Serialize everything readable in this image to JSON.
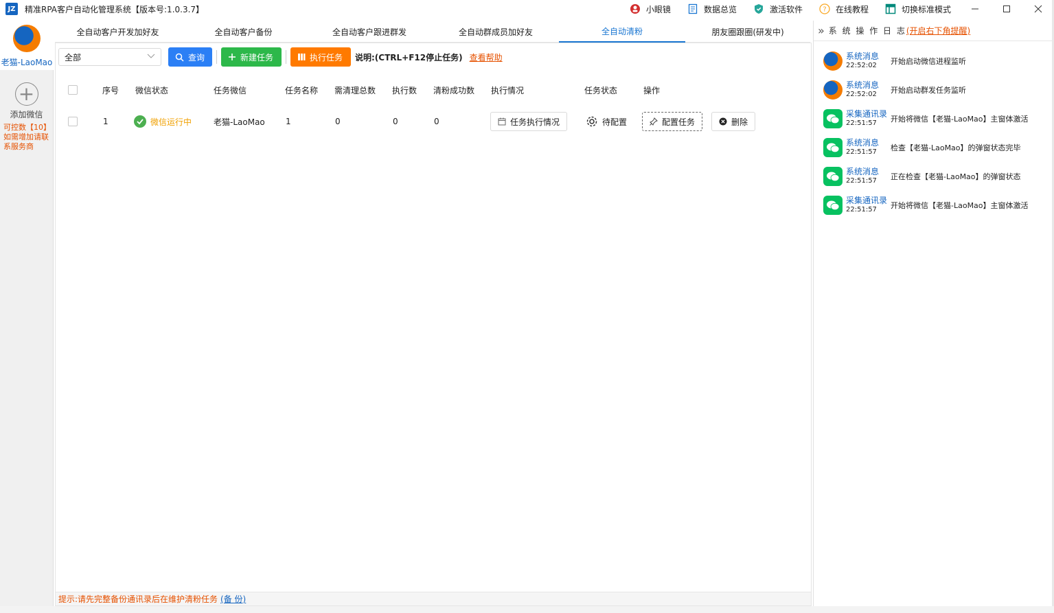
{
  "window": {
    "logo_text": "JZ",
    "title": "精准RPA客户自动化管理系统【版本号:1.0.3.7】",
    "actions": [
      {
        "label": "小眼镜",
        "icon": "user-circle-icon"
      },
      {
        "label": "数据总览",
        "icon": "document-icon"
      },
      {
        "label": "激活软件",
        "icon": "shield-icon"
      },
      {
        "label": "在线教程",
        "icon": "help-icon"
      },
      {
        "label": "切换标准模式",
        "icon": "layout-icon"
      }
    ]
  },
  "left": {
    "account_name": "老猫-LaoMao",
    "add_label": "添加微信",
    "quota_text": "可控数【10】如需增加请联系服务商"
  },
  "tabs": [
    {
      "label": "全自动客户开发加好友"
    },
    {
      "label": "全自动客户备份"
    },
    {
      "label": "全自动客户跟进群发"
    },
    {
      "label": "全自动群成员加好友"
    },
    {
      "label": "全自动清粉",
      "active": true
    },
    {
      "label": "朋友圈跟圈(研发中)"
    }
  ],
  "toolbar": {
    "filter_value": "全部",
    "query_label": "查询",
    "new_task_label": "新建任务",
    "run_task_label": "执行任务",
    "note": "说明:(CTRL+F12停止任务)",
    "help_link": "查看帮助"
  },
  "table": {
    "headers": [
      "序号",
      "微信状态",
      "任务微信",
      "任务名称",
      "需清理总数",
      "执行数",
      "清粉成功数",
      "执行情况",
      "任务状态",
      "操作"
    ],
    "rows": [
      {
        "index": "1",
        "wx_status": "微信运行中",
        "task_wx": "老猫-LaoMao",
        "task_name": "1",
        "total": "0",
        "executed": "0",
        "success": "0",
        "exec_btn": "任务执行情况",
        "task_status": "待配置",
        "config_btn": "配置任务",
        "delete_btn": "删除"
      }
    ]
  },
  "hint": {
    "text": "提示:请先完整备份通讯录后在维护清粉任务",
    "link": "(备 份)"
  },
  "log": {
    "title": "系 统 操 作 日 志",
    "warn": "(开启右下角提醒)",
    "items": [
      {
        "type": "系统消息",
        "time": "22:52:02",
        "msg": "开始启动微信进程监听",
        "icon": "app-logo-icon"
      },
      {
        "type": "系统消息",
        "time": "22:52:02",
        "msg": "开始启动群发任务监听",
        "icon": "app-logo-icon"
      },
      {
        "type": "采集通讯录",
        "time": "22:51:57",
        "msg": "开始将微信【老猫-LaoMao】主窗体激活",
        "icon": "wechat-icon"
      },
      {
        "type": "系统消息",
        "time": "22:51:57",
        "msg": "检查【老猫-LaoMao】的弹窗状态完毕",
        "icon": "wechat-icon"
      },
      {
        "type": "系统消息",
        "time": "22:51:57",
        "msg": "正在检查【老猫-LaoMao】的弹窗状态",
        "icon": "wechat-icon"
      },
      {
        "type": "采集通讯录",
        "time": "22:51:57",
        "msg": "开始将微信【老猫-LaoMao】主窗体激活",
        "icon": "wechat-icon"
      }
    ]
  }
}
